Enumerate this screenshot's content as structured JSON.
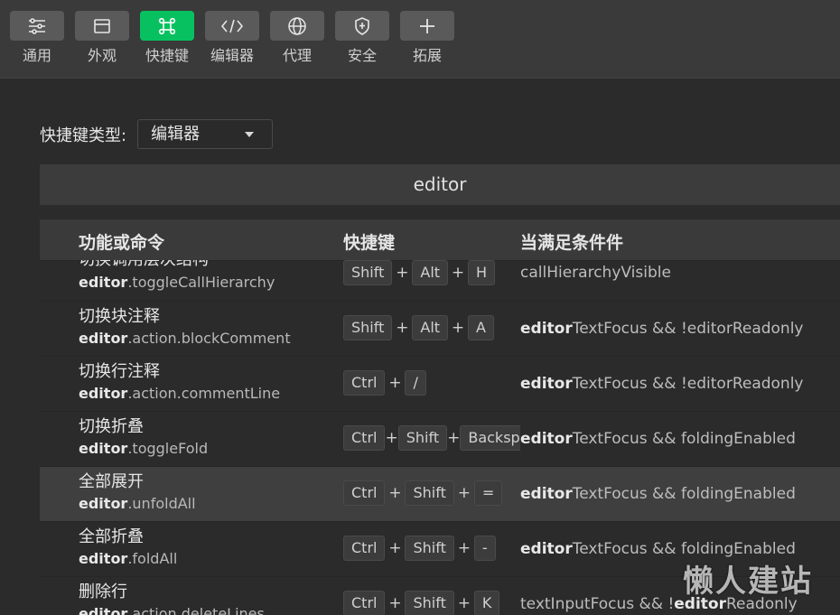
{
  "toolbar": {
    "items": [
      {
        "label": "通用",
        "icon": "sliders-icon"
      },
      {
        "label": "外观",
        "icon": "window-icon"
      },
      {
        "label": "快捷键",
        "icon": "command-key-icon"
      },
      {
        "label": "编辑器",
        "icon": "code-icon"
      },
      {
        "label": "代理",
        "icon": "globe-icon"
      },
      {
        "label": "安全",
        "icon": "shield-icon"
      },
      {
        "label": "拓展",
        "icon": "plus-icon"
      }
    ],
    "active_color": "#07c160"
  },
  "shortcut_type": {
    "label": "快捷键类型:",
    "value": "编辑器"
  },
  "section_title": "editor",
  "table": {
    "headers": {
      "command": "功能或命令",
      "shortcut": "快捷键",
      "condition": "当满足条件件"
    },
    "rows": [
      {
        "name": "切换调用层次结构",
        "cmd_bold": "editor",
        "cmd_rest": ".toggleCallHierarchy",
        "keys": [
          "Shift",
          "Alt",
          "H"
        ],
        "cond_bold": "",
        "cond_rest": "callHierarchyVisible",
        "cond_tail_bold": "",
        "cond_tail": ""
      },
      {
        "name": "切换块注释",
        "cmd_bold": "editor",
        "cmd_rest": ".action.blockComment",
        "keys": [
          "Shift",
          "Alt",
          "A"
        ],
        "cond_bold": "editor",
        "cond_rest": "TextFocus && !editorReadonly",
        "cond_tail_bold": "",
        "cond_tail": ""
      },
      {
        "name": "切换行注释",
        "cmd_bold": "editor",
        "cmd_rest": ".action.commentLine",
        "keys": [
          "Ctrl",
          "/"
        ],
        "cond_bold": "editor",
        "cond_rest": "TextFocus && !editorReadonly",
        "cond_tail_bold": "",
        "cond_tail": ""
      },
      {
        "name": "切换折叠",
        "cmd_bold": "editor",
        "cmd_rest": ".toggleFold",
        "keys": [
          "Ctrl",
          "Shift",
          "Backspace"
        ],
        "cond_bold": "editor",
        "cond_rest": "TextFocus && foldingEnabled",
        "cond_tail_bold": "",
        "cond_tail": ""
      },
      {
        "name": "全部展开",
        "cmd_bold": "editor",
        "cmd_rest": ".unfoldAll",
        "keys": [
          "Ctrl",
          "Shift",
          "="
        ],
        "cond_bold": "editor",
        "cond_rest": "TextFocus && foldingEnabled",
        "cond_tail_bold": "",
        "cond_tail": ""
      },
      {
        "name": "全部折叠",
        "cmd_bold": "editor",
        "cmd_rest": ".foldAll",
        "keys": [
          "Ctrl",
          "Shift",
          "-"
        ],
        "cond_bold": "editor",
        "cond_rest": "TextFocus && foldingEnabled",
        "cond_tail_bold": "",
        "cond_tail": ""
      },
      {
        "name": "删除行",
        "cmd_bold": "editor",
        "cmd_rest": ".action.deleteLines",
        "keys": [
          "Ctrl",
          "Shift",
          "K"
        ],
        "cond_bold": "",
        "cond_rest": "textInputFocus && !",
        "cond_tail_bold": "editor",
        "cond_tail": "Readonly"
      }
    ]
  },
  "watermark": "懒人建站"
}
